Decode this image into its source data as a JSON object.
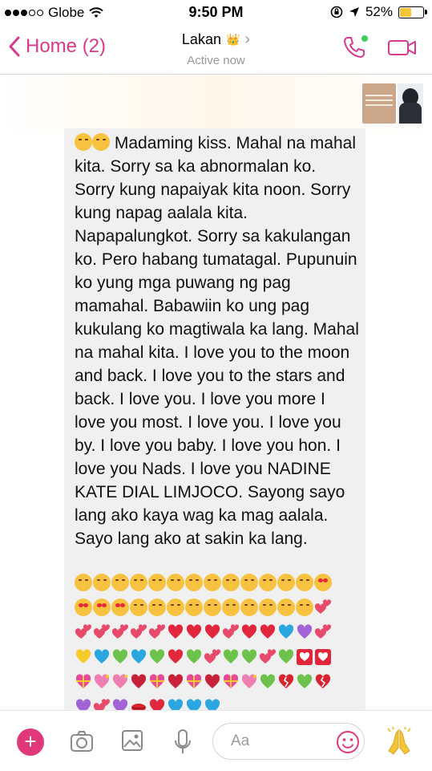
{
  "status_bar": {
    "carrier": "Globe",
    "time": "9:50 PM",
    "battery": "52%",
    "battery_level": 0.52,
    "accent_battery": "#f4c534"
  },
  "header": {
    "back_label": "Home (2)",
    "contact_name": "Lakan",
    "crown_emoji": "👑",
    "status": "Active now",
    "accent": "#d63a8c"
  },
  "message": {
    "text": "Madaming kiss. Mahal na mahal kita. Sorry sa ka abnormalan ko. Sorry kung napaiyak kita noon. Sorry kung napag aalala kita. Napapalungkot. Sorry sa kakulangan ko. Pero habang tumatagal. Pupunuin ko yung mga puwang ng pag mamahal. Babawiin ko ung pag kukulang ko magtiwala ka lang. Mahal na mahal kita. I love you to the moon and back. I love you to the stars and back. I love you. I love you more I love you most. I love you. I love you by. I love you baby. I love you hon. I love you Nads. I love you NADINE KATE DIAL LIMJOCO. Sayong sayo lang ako kaya wag ka mag aalala. Sayo lang ako at sakin ka lang.",
    "leading_emojis": [
      "kiss-face",
      "kiss-face"
    ],
    "emoji_rows": [
      [
        "kiss-face",
        "kiss-face",
        "kiss-face",
        "kiss-face",
        "kiss-face",
        "kiss-face",
        "kiss-face",
        "kiss-face",
        "kiss-face",
        "kiss-face",
        "kiss-face",
        "kiss-face",
        "kiss-face",
        "heart-eyes-face"
      ],
      [
        "heart-eyes-face",
        "heart-eyes-face",
        "heart-eyes-face",
        "kiss-face",
        "kiss-face",
        "kiss-face",
        "kiss-face",
        "kiss-face",
        "kiss-face",
        "kiss-face",
        "kiss-face",
        "kiss-face",
        "kiss-face",
        "two-hearts"
      ],
      [
        "two-hearts",
        "two-hearts",
        "two-hearts",
        "two-hearts",
        "two-hearts",
        "red-heart",
        "red-heart",
        "red-heart",
        "two-hearts",
        "red-heart",
        "red-heart",
        "blue-heart",
        "purple-heart",
        "two-hearts"
      ],
      [
        "yellow-heart",
        "blue-heart",
        "green-heart",
        "blue-heart",
        "green-heart",
        "red-heart",
        "green-heart",
        "two-hearts",
        "green-heart",
        "green-heart",
        "two-hearts",
        "green-heart",
        "heart-box",
        "heart-box"
      ],
      [
        "ribbon-heart",
        "sparkling-heart",
        "sparkling-heart",
        "heart-beat",
        "ribbon-heart",
        "heart-beat",
        "ribbon-heart",
        "heart-beat",
        "ribbon-heart",
        "sparkling-heart",
        "green-heart",
        "broken-heart",
        "green-heart",
        "broken-heart"
      ],
      [
        "purple-heart",
        "two-hearts",
        "purple-heart",
        "kiss-lips",
        "red-heart",
        "blue-heart",
        "blue-heart",
        "blue-heart"
      ]
    ]
  },
  "composer": {
    "placeholder": "Aa",
    "plus_color": "#e0397a"
  }
}
